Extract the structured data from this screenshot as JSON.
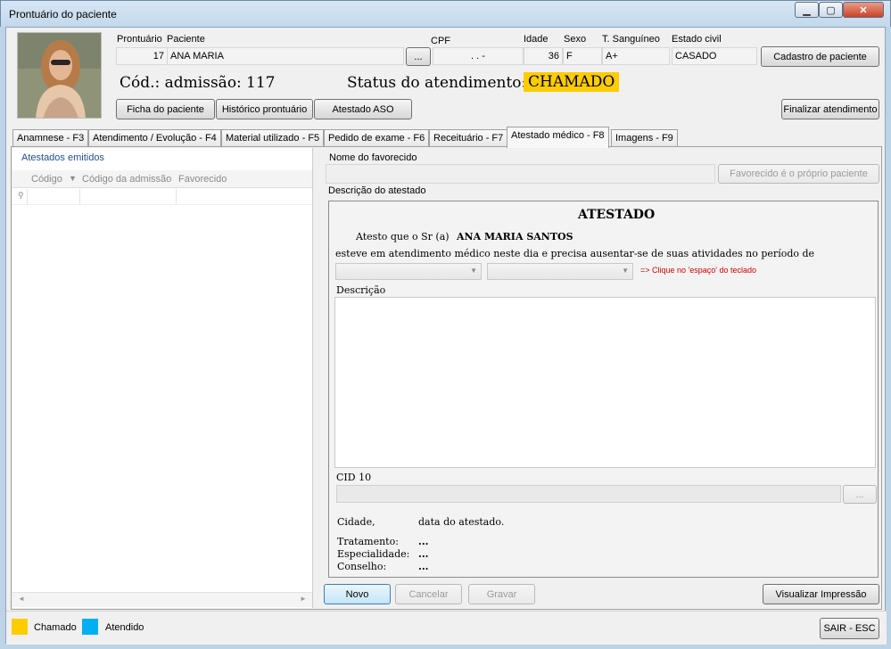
{
  "window": {
    "title": "Prontuário do paciente"
  },
  "patient": {
    "labels": {
      "prontuario": "Prontuário",
      "paciente": "Paciente",
      "cpf": "CPF",
      "idade": "Idade",
      "sexo": "Sexo",
      "sangue": "T. Sanguíneo",
      "civil": "Estado civil"
    },
    "prontuario": "17",
    "nome": "ANA MARIA",
    "ellipsis": "...",
    "cpf": ".   .   -",
    "idade": "36",
    "sexo": "F",
    "sangue": "A+",
    "civil": "CASADO"
  },
  "header": {
    "cadastro_label": "Cadastro de paciente",
    "admissao_label": "Cód.: admissão:",
    "admissao_value": "117",
    "status_label": "Status do atendimento:",
    "status_value": "CHAMADO",
    "ficha_label": "Ficha do paciente",
    "historico_label": "Histórico prontuário",
    "aso_label": "Atestado ASO",
    "finalizar_label": "Finalizar atendimento"
  },
  "tabs": [
    "Anamnese - F3",
    "Atendimento / Evolução - F4",
    "Material utilizado - F5",
    "Pedido de exame - F6",
    "Receituário - F7",
    "Atestado médico - F8",
    "Imagens - F9"
  ],
  "left": {
    "title": "Atestados emitidos",
    "columns": [
      "Código",
      "Código da admissão",
      "Favorecido"
    ]
  },
  "form": {
    "favorecido_label": "Nome do favorecido",
    "favorecido_value": "",
    "proprio_label": "Favorecido é o próprio paciente",
    "descricao_label": "Descrição do atestado"
  },
  "certificate": {
    "heading": "ATESTADO",
    "atesto": "Atesto que o Sr (a)",
    "patient": "ANA MARIA SANTOS",
    "body": "esteve em atendimento médico neste dia e precisa ausentar-se de suas atividades no período de",
    "hint": "=> Clique no 'espaço' do teclado",
    "descricao_label": "Descrição",
    "cid_label": "CID 10",
    "cid_btn": "...",
    "cidade": "Cidade,",
    "data": "data do atestado.",
    "tratamento_label": "Tratamento:",
    "tratamento_value": "...",
    "especialidade_label": "Especialidade:",
    "especialidade_value": "...",
    "conselho_label": "Conselho:",
    "conselho_value": "..."
  },
  "actions": {
    "novo": "Novo",
    "cancelar": "Cancelar",
    "gravar": "Gravar",
    "visualizar": "Visualizar Impressão"
  },
  "legend": [
    {
      "label": "Chamado",
      "color": "#ffcc00"
    },
    {
      "label": "Atendido",
      "color": "#00b0f0"
    }
  ],
  "footer": {
    "sair": "SAIR - ESC"
  }
}
